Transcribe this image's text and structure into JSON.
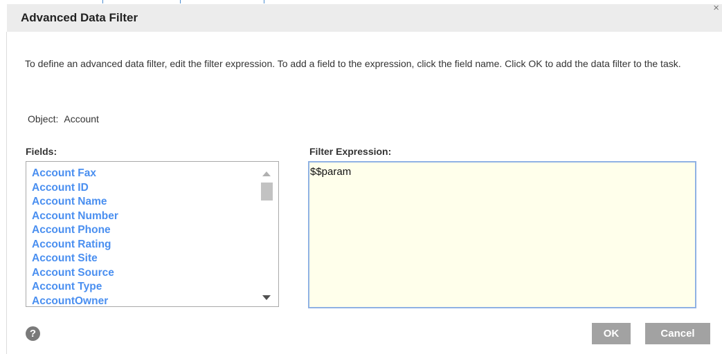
{
  "dialog": {
    "title": "Advanced Data Filter",
    "close_glyph": "×",
    "instructions": "To define an advanced data filter, edit the filter expression. To add a field to the expression, click the field name. Click OK to add the data filter to the task.",
    "object_label": "Object:",
    "object_value": "Account",
    "fields_label": "Fields:",
    "filter_label": "Filter Expression:",
    "fields": [
      "Account Fax",
      "Account ID",
      "Account Name",
      "Account Number",
      "Account Phone",
      "Account Rating",
      "Account Site",
      "Account Source",
      "Account Type",
      "AccountOwner"
    ],
    "filter_expression": "$$param",
    "help_glyph": "?",
    "ok_label": "OK",
    "cancel_label": "Cancel"
  },
  "icons": {
    "close": "close-icon",
    "help": "help-icon",
    "scroll_up": "chevron-up-icon",
    "scroll_down": "chevron-down-icon"
  },
  "colors": {
    "title_bar": "#ececec",
    "field_link": "#4a8ff0",
    "filter_bg": "#ffffeb",
    "filter_border": "#8fb1e3",
    "button_bg": "#a2a2a2"
  }
}
